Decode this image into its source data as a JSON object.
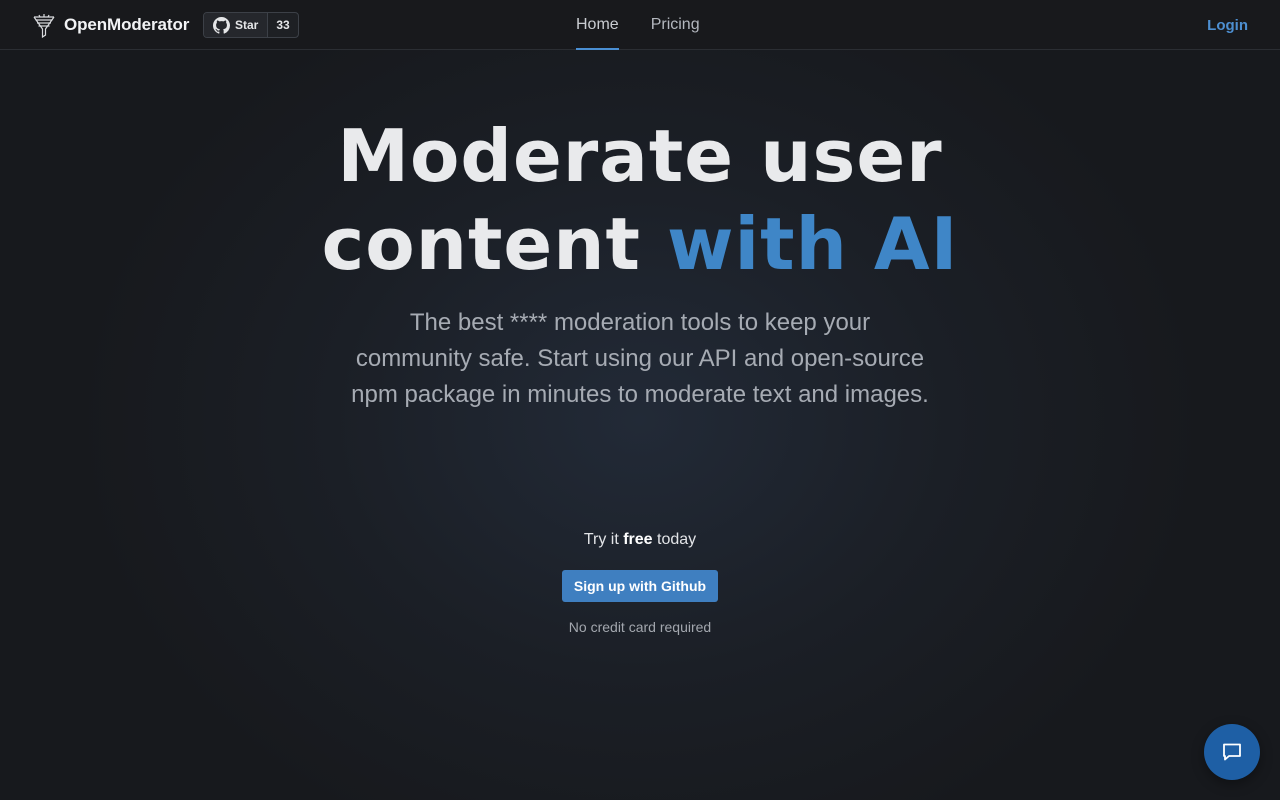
{
  "header": {
    "brand": "OpenModerator",
    "github_star": {
      "label": "Star",
      "count": "33"
    },
    "nav": [
      {
        "label": "Home",
        "active": true
      },
      {
        "label": "Pricing",
        "active": false
      }
    ],
    "login": "Login"
  },
  "hero": {
    "title_line1": "Moderate user",
    "title_line2_plain": "content ",
    "title_line2_accent": "with AI",
    "subtitle": "The best **** moderation tools to keep your community safe. Start using our API and open-source npm package in minutes to moderate text and images."
  },
  "cta": {
    "try_prefix": "Try it ",
    "try_bold": "free",
    "try_suffix": " today",
    "signup_button": "Sign up with Github",
    "note": "No credit card required"
  },
  "colors": {
    "accent": "#3f86c7",
    "button": "#3f7fc0",
    "chat_button": "#1e5fa5",
    "background": "#1b1f26"
  },
  "icons": {
    "logo": "funnel-logo-icon",
    "github": "github-icon",
    "chat": "chat-bubble-icon"
  }
}
